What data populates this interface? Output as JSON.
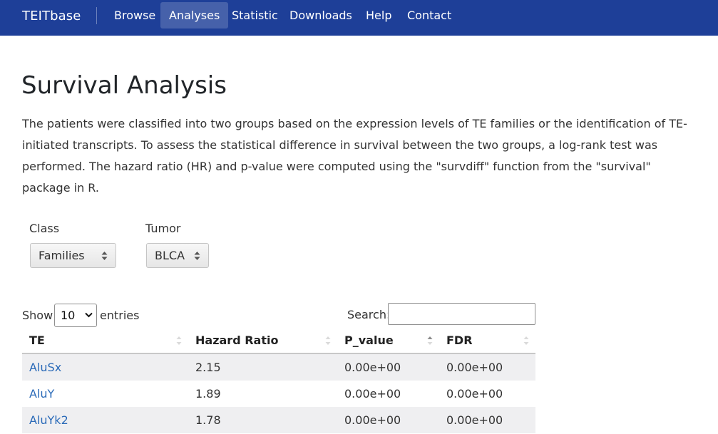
{
  "navbar": {
    "brand": "TEITbase",
    "items": [
      {
        "label": "Browse",
        "active": false
      },
      {
        "label": "Analyses",
        "active": true
      },
      {
        "label": "Statistic",
        "active": false
      },
      {
        "label": "Downloads",
        "active": false
      },
      {
        "label": "Help",
        "active": false
      },
      {
        "label": "Contact",
        "active": false
      }
    ]
  },
  "page": {
    "title": "Survival Analysis",
    "description": "The patients were classified into two groups based on the expression levels of TE families or the identification of TE-initiated transcripts. To assess the statistical difference in survival between the two groups, a log-rank test was performed. The hazard ratio (HR) and p-value were computed using the \"survdiff\" function from the \"survival\" package in R."
  },
  "filters": {
    "class": {
      "label": "Class",
      "value": "Families"
    },
    "tumor": {
      "label": "Tumor",
      "value": "BLCA"
    }
  },
  "table_controls": {
    "show_label": "Show",
    "entries_label": "entries",
    "page_length": "10",
    "search_label": "Search:",
    "search_value": ""
  },
  "table": {
    "columns": [
      "TE",
      "Hazard Ratio",
      "P_value",
      "FDR"
    ],
    "sorted_column": "P_value",
    "sort_direction": "ascending",
    "rows": [
      {
        "te": "AluSx",
        "hazard_ratio": "2.15",
        "p_value": "0.00e+00",
        "fdr": "0.00e+00"
      },
      {
        "te": "AluY",
        "hazard_ratio": "1.89",
        "p_value": "0.00e+00",
        "fdr": "0.00e+00"
      },
      {
        "te": "AluYk2",
        "hazard_ratio": "1.78",
        "p_value": "0.00e+00",
        "fdr": "0.00e+00"
      }
    ]
  },
  "colors": {
    "navbar_bg": "#1e3f98",
    "link": "#2a6ab8",
    "striped_row": "#efeff1"
  }
}
